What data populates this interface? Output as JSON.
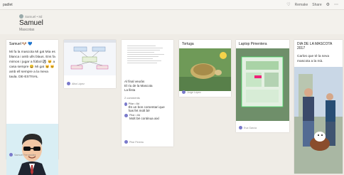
{
  "topbar": {
    "brand": "padlet",
    "actions": [
      "Remake",
      "Share"
    ]
  },
  "header": {
    "author": "Samuel • 8d",
    "title": "Samuel",
    "subtitle": "Mascotas"
  },
  "cards": [
    {
      "title": "Samuel 🐶 💙",
      "text": "Mi fa la mascota Mi gat Mia es blanca i amb ulls blaus. Ens fa mimos i jugar a fútbol ⚽ 🐱 a casa sempre 😀 Mi gat 😺 🐱 amb ell sempre a la meva taula. DE-ESTIVAL",
      "footer": "Samuel Fernandez"
    },
    {
      "footer": "Alba López"
    },
    {
      "text_lines": [
        "Al final veuràs",
        "El riu de la Mascota",
        "La llista"
      ],
      "comments_label": "2 comments",
      "comments": [
        {
          "author": "Pilar • 8d",
          "text": "És un bon comentari que has fet molt bé"
        },
        {
          "author": "Pilar • 8d",
          "text": "Molt bé continua així"
        }
      ],
      "footer": "Pilar Pereira"
    },
    {
      "title": "Tortuga",
      "footer": "Jorge López"
    },
    {
      "title": "Laptop Pimentera",
      "footer": "Eva García"
    },
    {
      "title": "DIA DE LA MASCOTA 2017",
      "text": "Carlos que té la seva mascota a la mà."
    }
  ],
  "colors": {
    "background": "#efece6",
    "card": "#ffffff",
    "avatar": "#7a7acb"
  }
}
